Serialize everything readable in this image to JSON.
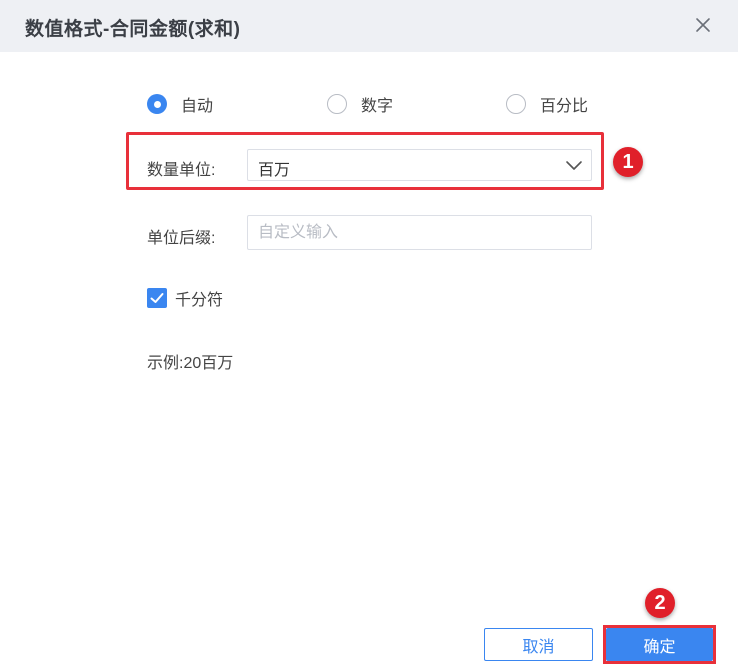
{
  "dialog": {
    "title": "数值格式-合同金额(求和)",
    "close_icon": "close-icon"
  },
  "format_options": {
    "selected": "自动",
    "items": [
      {
        "label": "自动",
        "checked": true
      },
      {
        "label": "数字",
        "checked": false
      },
      {
        "label": "百分比",
        "checked": false
      }
    ]
  },
  "unit": {
    "label": "数量单位:",
    "value": "百万",
    "icon": "chevron-down-icon"
  },
  "suffix": {
    "label": "单位后缀:",
    "value": "",
    "placeholder": "自定义输入"
  },
  "thousands": {
    "label": "千分符",
    "checked": true
  },
  "example": {
    "text": "示例:20百万"
  },
  "annotations": {
    "badge1": "1",
    "badge2": "2",
    "highlight_color": "#e8303a"
  },
  "footer": {
    "cancel_label": "取消",
    "ok_label": "确定"
  },
  "colors": {
    "accent": "#3a86f0",
    "header_bg": "#eef0f4"
  }
}
